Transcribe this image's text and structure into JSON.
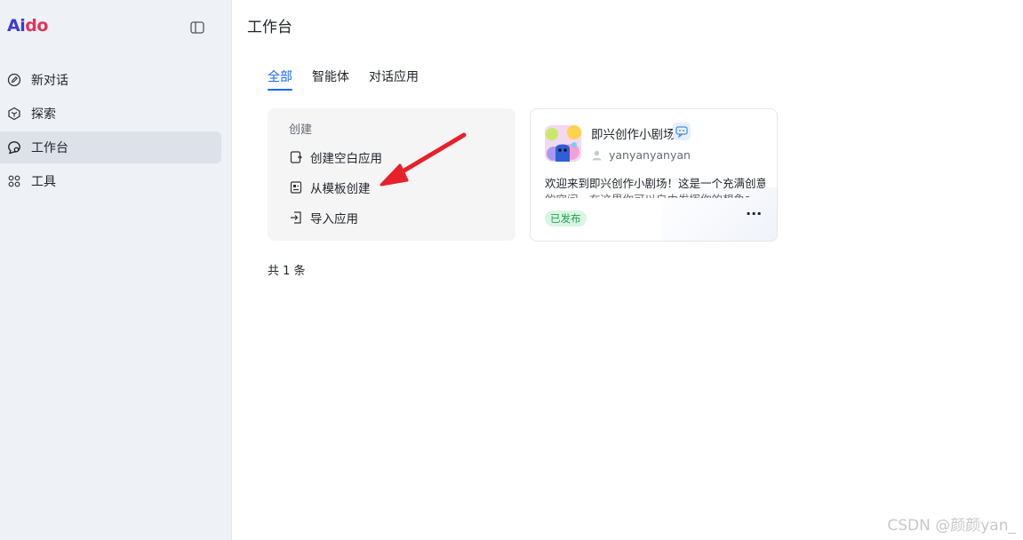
{
  "brand": {
    "logo_part1": "Ai",
    "logo_part2": "do"
  },
  "sidebar": {
    "items": [
      {
        "label": "新对话",
        "icon": "edit-icon"
      },
      {
        "label": "探索",
        "icon": "cube-icon"
      },
      {
        "label": "工作台",
        "icon": "workspace-icon"
      },
      {
        "label": "工具",
        "icon": "grid-icon"
      }
    ],
    "active_index": 2
  },
  "header": {
    "title": "工作台"
  },
  "tabs": [
    {
      "label": "全部",
      "active": true
    },
    {
      "label": "智能体",
      "active": false
    },
    {
      "label": "对话应用",
      "active": false
    }
  ],
  "create_panel": {
    "title": "创建",
    "items": [
      {
        "label": "创建空白应用",
        "icon": "blank-app-icon"
      },
      {
        "label": "从模板创建",
        "icon": "template-icon"
      },
      {
        "label": "导入应用",
        "icon": "import-icon"
      }
    ]
  },
  "app_card": {
    "name": "即兴创作小剧场",
    "author": "yanyanyanyan",
    "description": "欢迎来到即兴创作小剧场！这是一个充满创意",
    "description_line2": "的空间，在这里你可以自由发挥你的想象力",
    "status": "已发布",
    "more_label": "···"
  },
  "footer": {
    "total": "共 1 条"
  },
  "watermark": "CSDN @颜颜yan_",
  "colors": {
    "accent": "#1a66ff",
    "annotation_arrow": "#e8202a",
    "status_green": "#1f9f4c"
  }
}
